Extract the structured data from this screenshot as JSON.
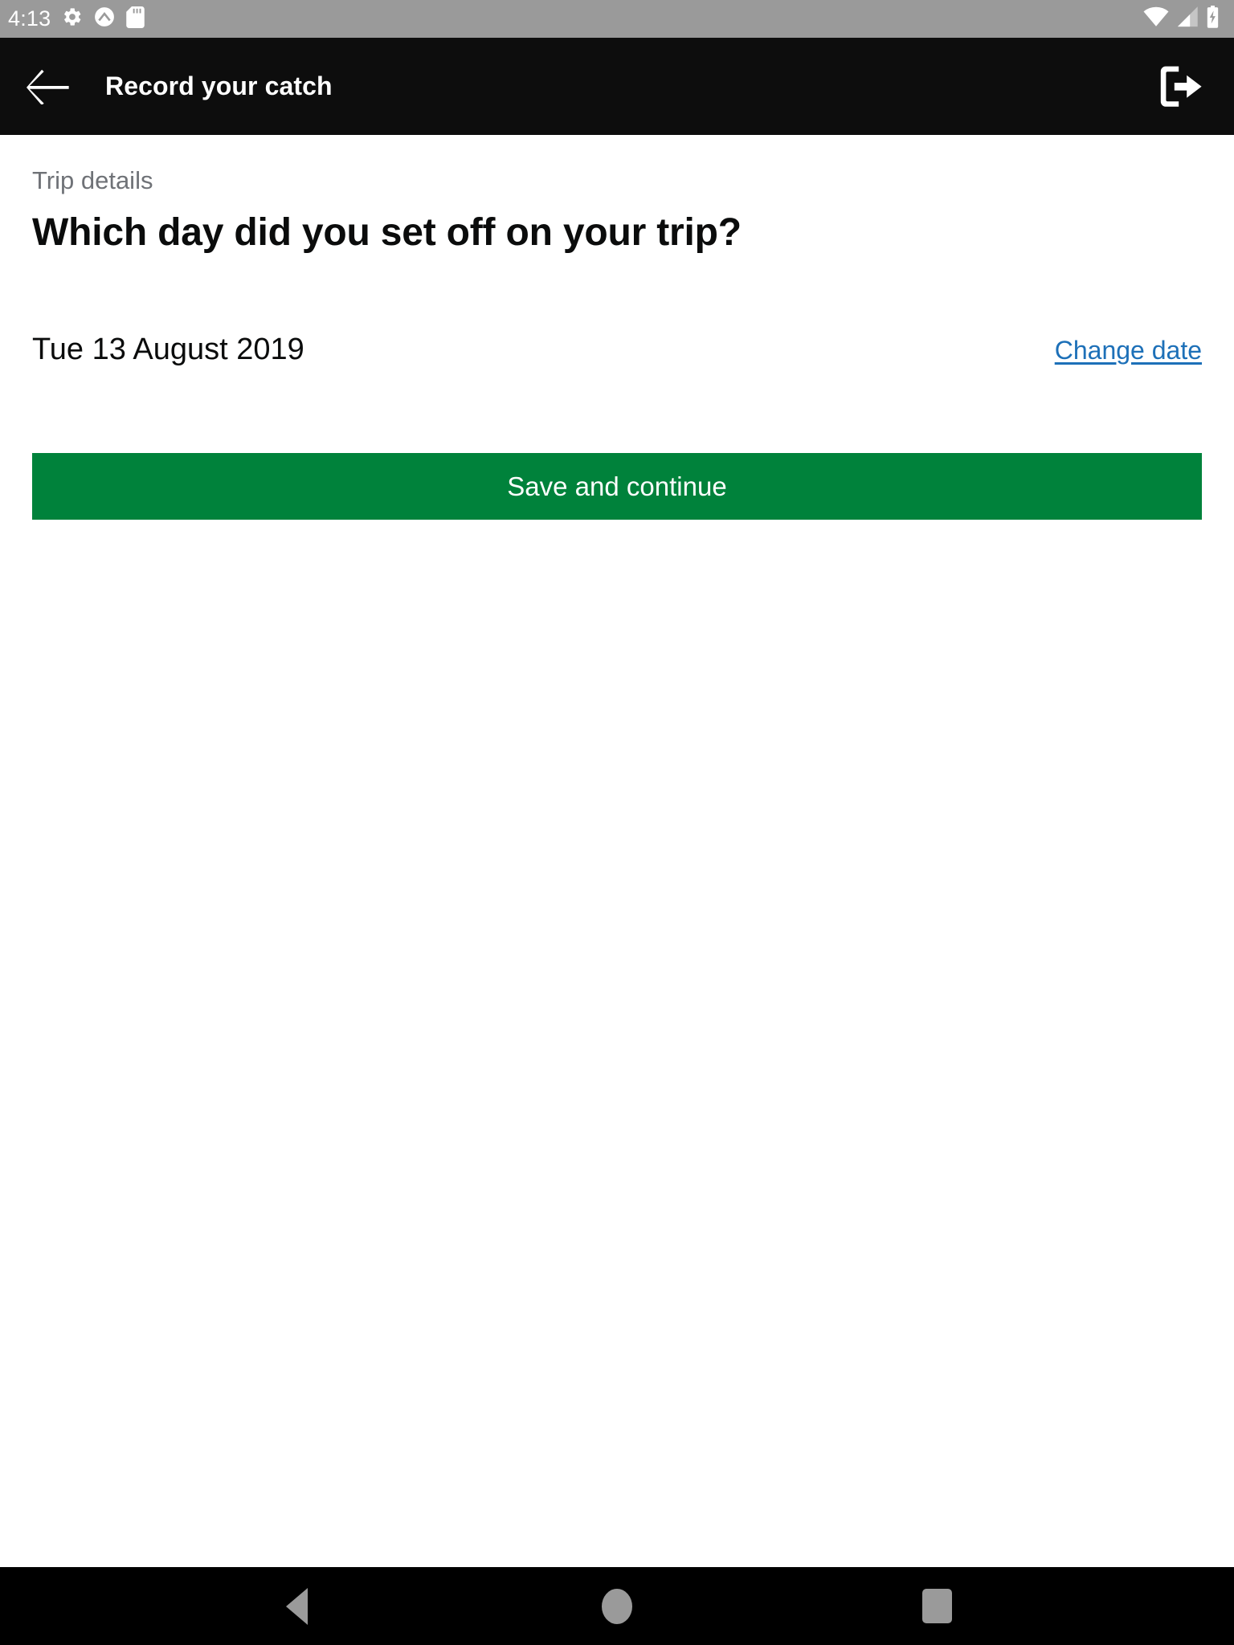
{
  "status_bar": {
    "clock": "4:13",
    "left_icons": [
      "gear-icon",
      "circle-chevron-up-icon",
      "sd-card-icon"
    ],
    "right_icons": [
      "wifi-icon",
      "cell-signal-icon",
      "battery-charging-icon"
    ],
    "background": "#9a9a9a",
    "foreground": "#ffffff"
  },
  "app_bar": {
    "title": "Record your catch",
    "back_icon": "arrow-left-icon",
    "logout_icon": "logout-icon",
    "background": "#0d0d0d",
    "foreground": "#ffffff"
  },
  "main": {
    "caption": "Trip details",
    "heading": "Which day did you set off on your trip?",
    "date_value": "Tue 13 August 2019",
    "change_link_label": "Change date",
    "link_color": "#1d70b8",
    "submit_label": "Save and continue",
    "submit_color": "#00823b"
  },
  "nav_bar": {
    "back_label": "Back",
    "home_label": "Home",
    "recents_label": "Recent apps",
    "background": "#000000",
    "foreground": "#9a9a9a"
  }
}
